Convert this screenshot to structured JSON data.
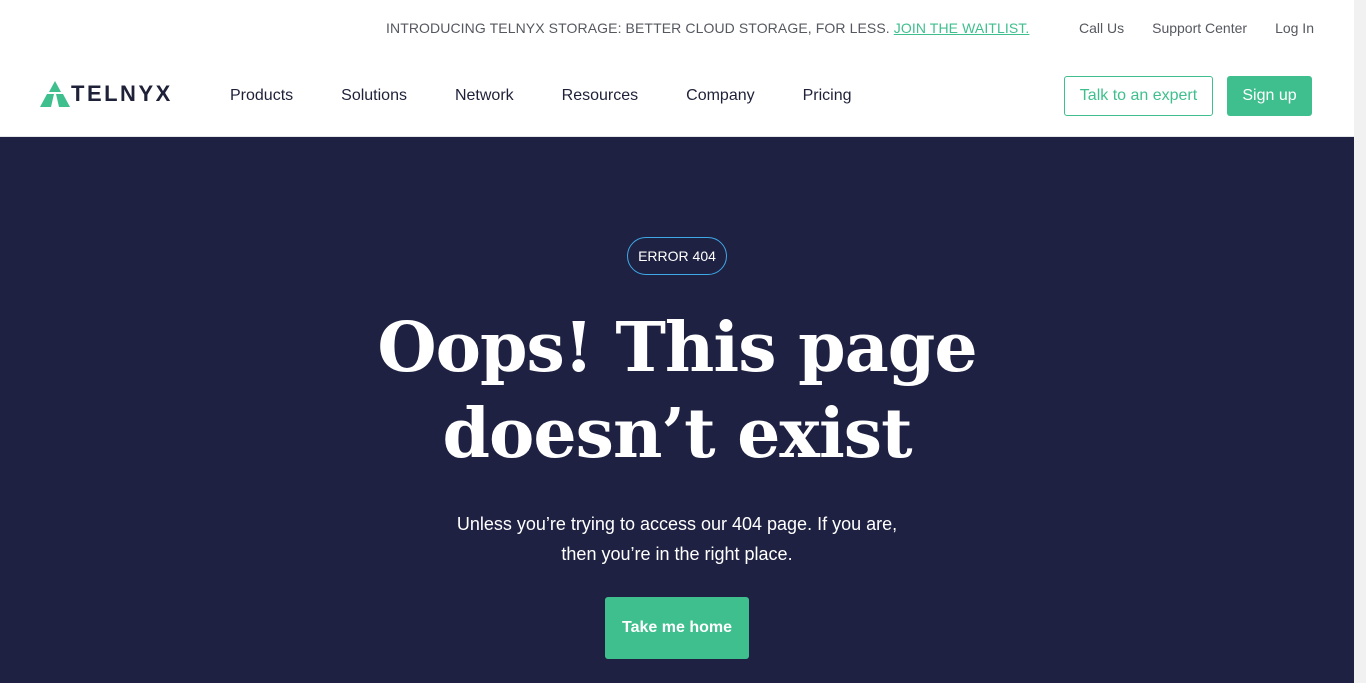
{
  "announcement": {
    "text": "INTRODUCING TELNYX STORAGE: BETTER CLOUD STORAGE, FOR LESS. ",
    "link": "JOIN THE WAITLIST."
  },
  "utility_links": [
    "Call Us",
    "Support Center",
    "Log In"
  ],
  "brand": {
    "name": "TELNYX",
    "accent": "#3fbf8e"
  },
  "nav": {
    "items": [
      "Products",
      "Solutions",
      "Network",
      "Resources",
      "Company",
      "Pricing"
    ],
    "talk_label": "Talk to an expert",
    "signup_label": "Sign up"
  },
  "hero": {
    "badge": "ERROR 404",
    "headline_line1": "Oops! This page",
    "headline_line2": "doesn’t exist",
    "sub_line1": "Unless you’re trying to access our 404 page. If you are,",
    "sub_line2": "then you’re in the right place.",
    "cta_label": "Take me home",
    "background": "#1e2142"
  }
}
